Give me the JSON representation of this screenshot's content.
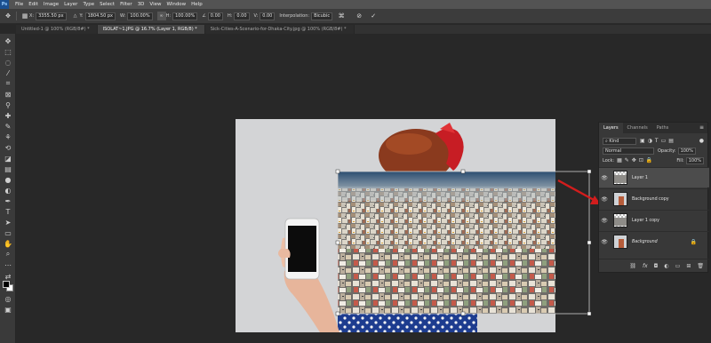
{
  "app": {
    "logo": "Ps"
  },
  "menu": [
    "File",
    "Edit",
    "Image",
    "Layer",
    "Type",
    "Select",
    "Filter",
    "3D",
    "View",
    "Window",
    "Help"
  ],
  "options": {
    "x_label": "X:",
    "x_value": "3355.50 px",
    "y_label": "Y:",
    "y_value": "1804.50 px",
    "w_label": "W:",
    "w_value": "100.00%",
    "h_label": "H:",
    "h_value": "100.00%",
    "angle_value": "0.00",
    "h2_label": "H:",
    "h2_value": "0.00",
    "v_label": "V:",
    "v_value": "0.00",
    "interp_label": "Interpolation:",
    "interp_value": "Bicubic",
    "cancel_icon": "⊘",
    "commit_icon": "✓"
  },
  "tabs": [
    {
      "label": "Untitled-1 @ 100% (RGB/8#) *"
    },
    {
      "label": "ISOLAT~1.JPG @ 16.7% (Layer 1, RGB/8) *"
    },
    {
      "label": "Sick-Cities-A-Scenario-for-Dhaka-City.jpg @ 100% (RGB/8#) *"
    }
  ],
  "layers_panel": {
    "tabs": [
      "Layers",
      "Channels",
      "Paths"
    ],
    "kind_label": "Kind",
    "blend_mode": "Normal",
    "opacity_label": "Opacity:",
    "opacity_value": "100%",
    "lock_label": "Lock:",
    "fill_label": "Fill:",
    "fill_value": "100%",
    "layers": [
      {
        "name": "Layer 1",
        "selected": true
      },
      {
        "name": "Background copy",
        "selected": false
      },
      {
        "name": "Layer 1 copy",
        "selected": false
      },
      {
        "name": "Background",
        "selected": false
      }
    ]
  },
  "colors": {
    "accent_arrow": "#d21d1d",
    "panel_bg": "#383838",
    "canvas_bg": "#282828"
  }
}
